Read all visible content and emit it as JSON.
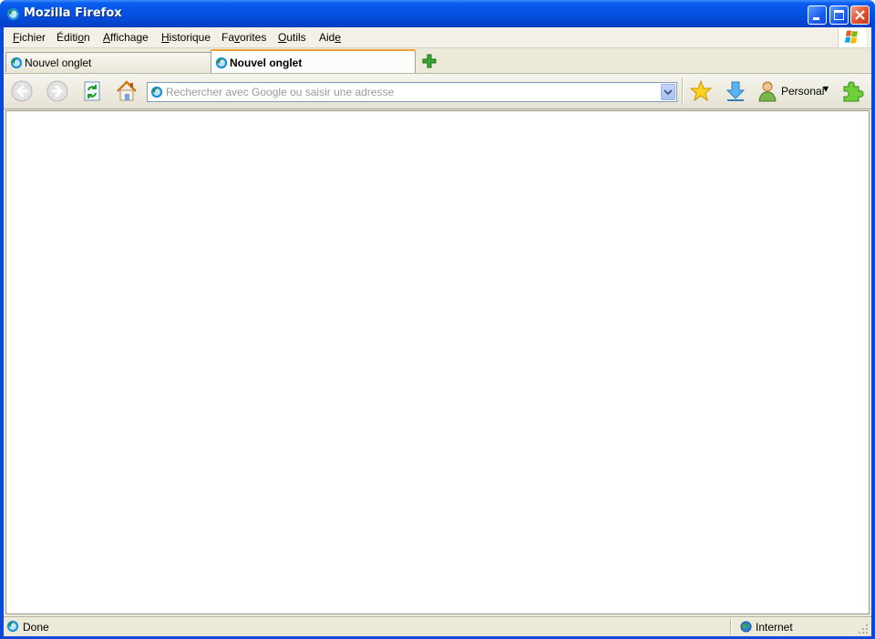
{
  "window": {
    "title": "Mozilla Firefox"
  },
  "menubar": {
    "items": [
      {
        "pre": "",
        "u": "F",
        "post": "ichier"
      },
      {
        "pre": "Éditi",
        "u": "o",
        "post": "n"
      },
      {
        "pre": "",
        "u": "A",
        "post": "ffichage"
      },
      {
        "pre": "",
        "u": "H",
        "post": "istorique"
      },
      {
        "pre": "Fa",
        "u": "v",
        "post": "orites"
      },
      {
        "pre": "",
        "u": "O",
        "post": "utils"
      },
      {
        "pre": "Aid",
        "u": "e",
        "post": ""
      }
    ]
  },
  "tabs": [
    {
      "label": "Nouvel onglet",
      "active": false
    },
    {
      "label": "Nouvel onglet",
      "active": true
    }
  ],
  "navbar": {
    "url_placeholder": "Rechercher avec Google ou saisir une adresse",
    "persona_label": "Personal"
  },
  "statusbar": {
    "status": "Done",
    "zone": "Internet"
  },
  "colors": {
    "titlebar": "#0554e2",
    "active_tab_accent": "#f0a030",
    "chrome": "#ece9d8"
  }
}
